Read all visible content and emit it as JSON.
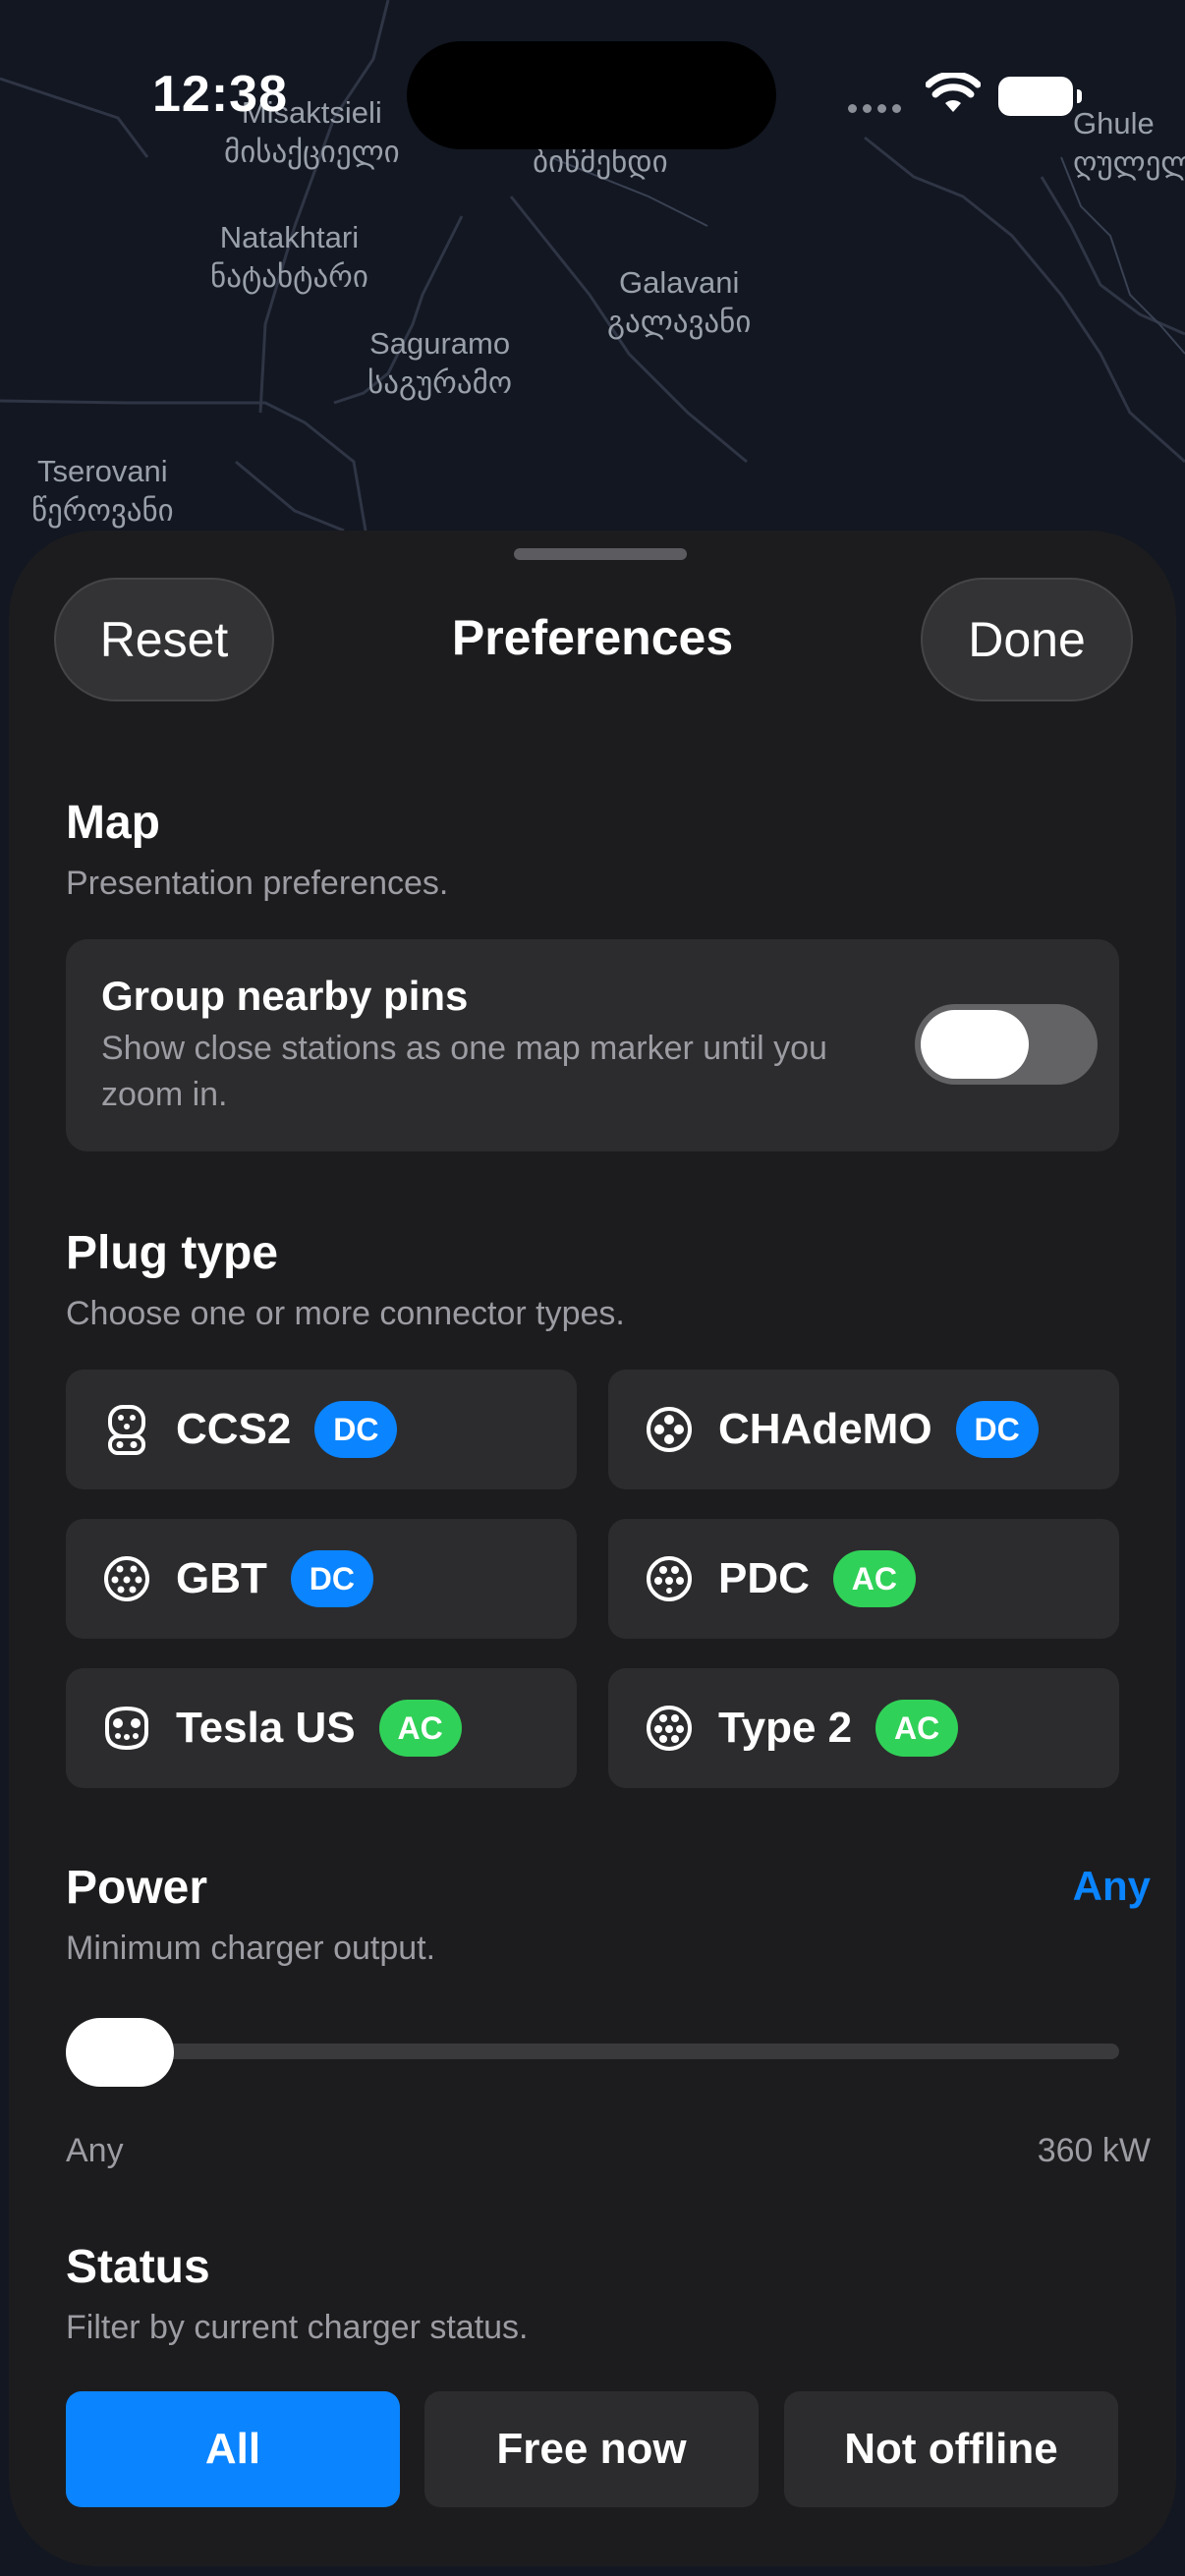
{
  "status_bar": {
    "time": "12:38",
    "icons": [
      "wifi-icon",
      "battery-icon"
    ]
  },
  "map": {
    "labels": [
      {
        "latin": "Misaktsieli",
        "local": "მისაქციელი"
      },
      {
        "latin": "",
        "local": "ბიწმენდი"
      },
      {
        "latin": "Ghule",
        "local": "ღულელ"
      },
      {
        "latin": "Natakhtari",
        "local": "ნატახტარი"
      },
      {
        "latin": "Galavani",
        "local": "გალავანი"
      },
      {
        "latin": "Saguramo",
        "local": "საგურამო"
      },
      {
        "latin": "Tserovani",
        "local": "წეროვანი"
      }
    ]
  },
  "header": {
    "reset_label": "Reset",
    "title": "Preferences",
    "done_label": "Done"
  },
  "map_section": {
    "title": "Map",
    "subtitle": "Presentation preferences.",
    "group_pins": {
      "title": "Group nearby pins",
      "description": "Show close stations as one map marker until you zoom in.",
      "enabled": true
    }
  },
  "plug_section": {
    "title": "Plug type",
    "subtitle": "Choose one or more connector types.",
    "plugs": [
      {
        "name": "CCS2",
        "badge": "DC"
      },
      {
        "name": "CHAdeMO",
        "badge": "DC"
      },
      {
        "name": "GBT",
        "badge": "DC"
      },
      {
        "name": "PDC",
        "badge": "AC"
      },
      {
        "name": "Tesla US",
        "badge": "AC"
      },
      {
        "name": "Type 2",
        "badge": "AC"
      }
    ]
  },
  "power_section": {
    "title": "Power",
    "value": "Any",
    "subtitle": "Minimum charger output.",
    "slider_min": "Any",
    "slider_max": "360 kW",
    "slider_level": 0
  },
  "status_section": {
    "title": "Status",
    "subtitle": "Filter by current charger status.",
    "options": [
      {
        "label": "All",
        "selected": true
      },
      {
        "label": "Free now",
        "selected": false
      },
      {
        "label": "Not offline",
        "selected": false
      }
    ]
  },
  "colors": {
    "accent": "#0a84ff",
    "dc_badge": "#0a84ff",
    "ac_badge": "#30d158",
    "sheet": "#1c1c1e",
    "card": "#2c2c2e"
  }
}
